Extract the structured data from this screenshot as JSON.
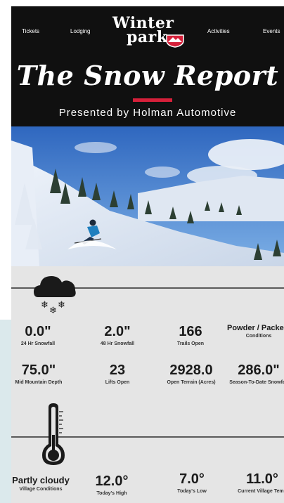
{
  "nav": {
    "tickets": "Tickets",
    "lodging": "Lodging",
    "activities": "Activities",
    "events": "Events"
  },
  "logo": {
    "line1": "Winter",
    "line2": "park"
  },
  "header": {
    "title": "The Snow Report",
    "presented": "Presented by Holman Automotive"
  },
  "colors": {
    "accent": "#d6203a",
    "header_bg": "#101010",
    "panel_bg": "#e5e5e5"
  },
  "icons": {
    "weather": "cloud-snow-icon",
    "temperature": "thermometer-icon"
  },
  "stats_row1": [
    {
      "value": "0.0\"",
      "label": "24 Hr Snowfall"
    },
    {
      "value": "2.0\"",
      "label": "48 Hr Snowfall"
    },
    {
      "value": "166",
      "label": "Trails Open"
    },
    {
      "value": "Powder / Packed Powder",
      "label": "Conditions"
    }
  ],
  "stats_row2": [
    {
      "value": "75.0\"",
      "label": "Mid Mountain Depth"
    },
    {
      "value": "23",
      "label": "Lifts Open"
    },
    {
      "value": "2928.0",
      "label": "Open Terrain (Acres)"
    },
    {
      "value": "286.0\"",
      "label": "Season-To-Date Snowfall"
    }
  ],
  "stats_row3": [
    {
      "value": "Partly cloudy",
      "label": "Village Conditions"
    },
    {
      "value": "12.0°",
      "label": "Today's High"
    },
    {
      "value": "7.0°",
      "label": "Today's Low"
    },
    {
      "value": "11.0°",
      "label": "Current Village Temp"
    }
  ]
}
